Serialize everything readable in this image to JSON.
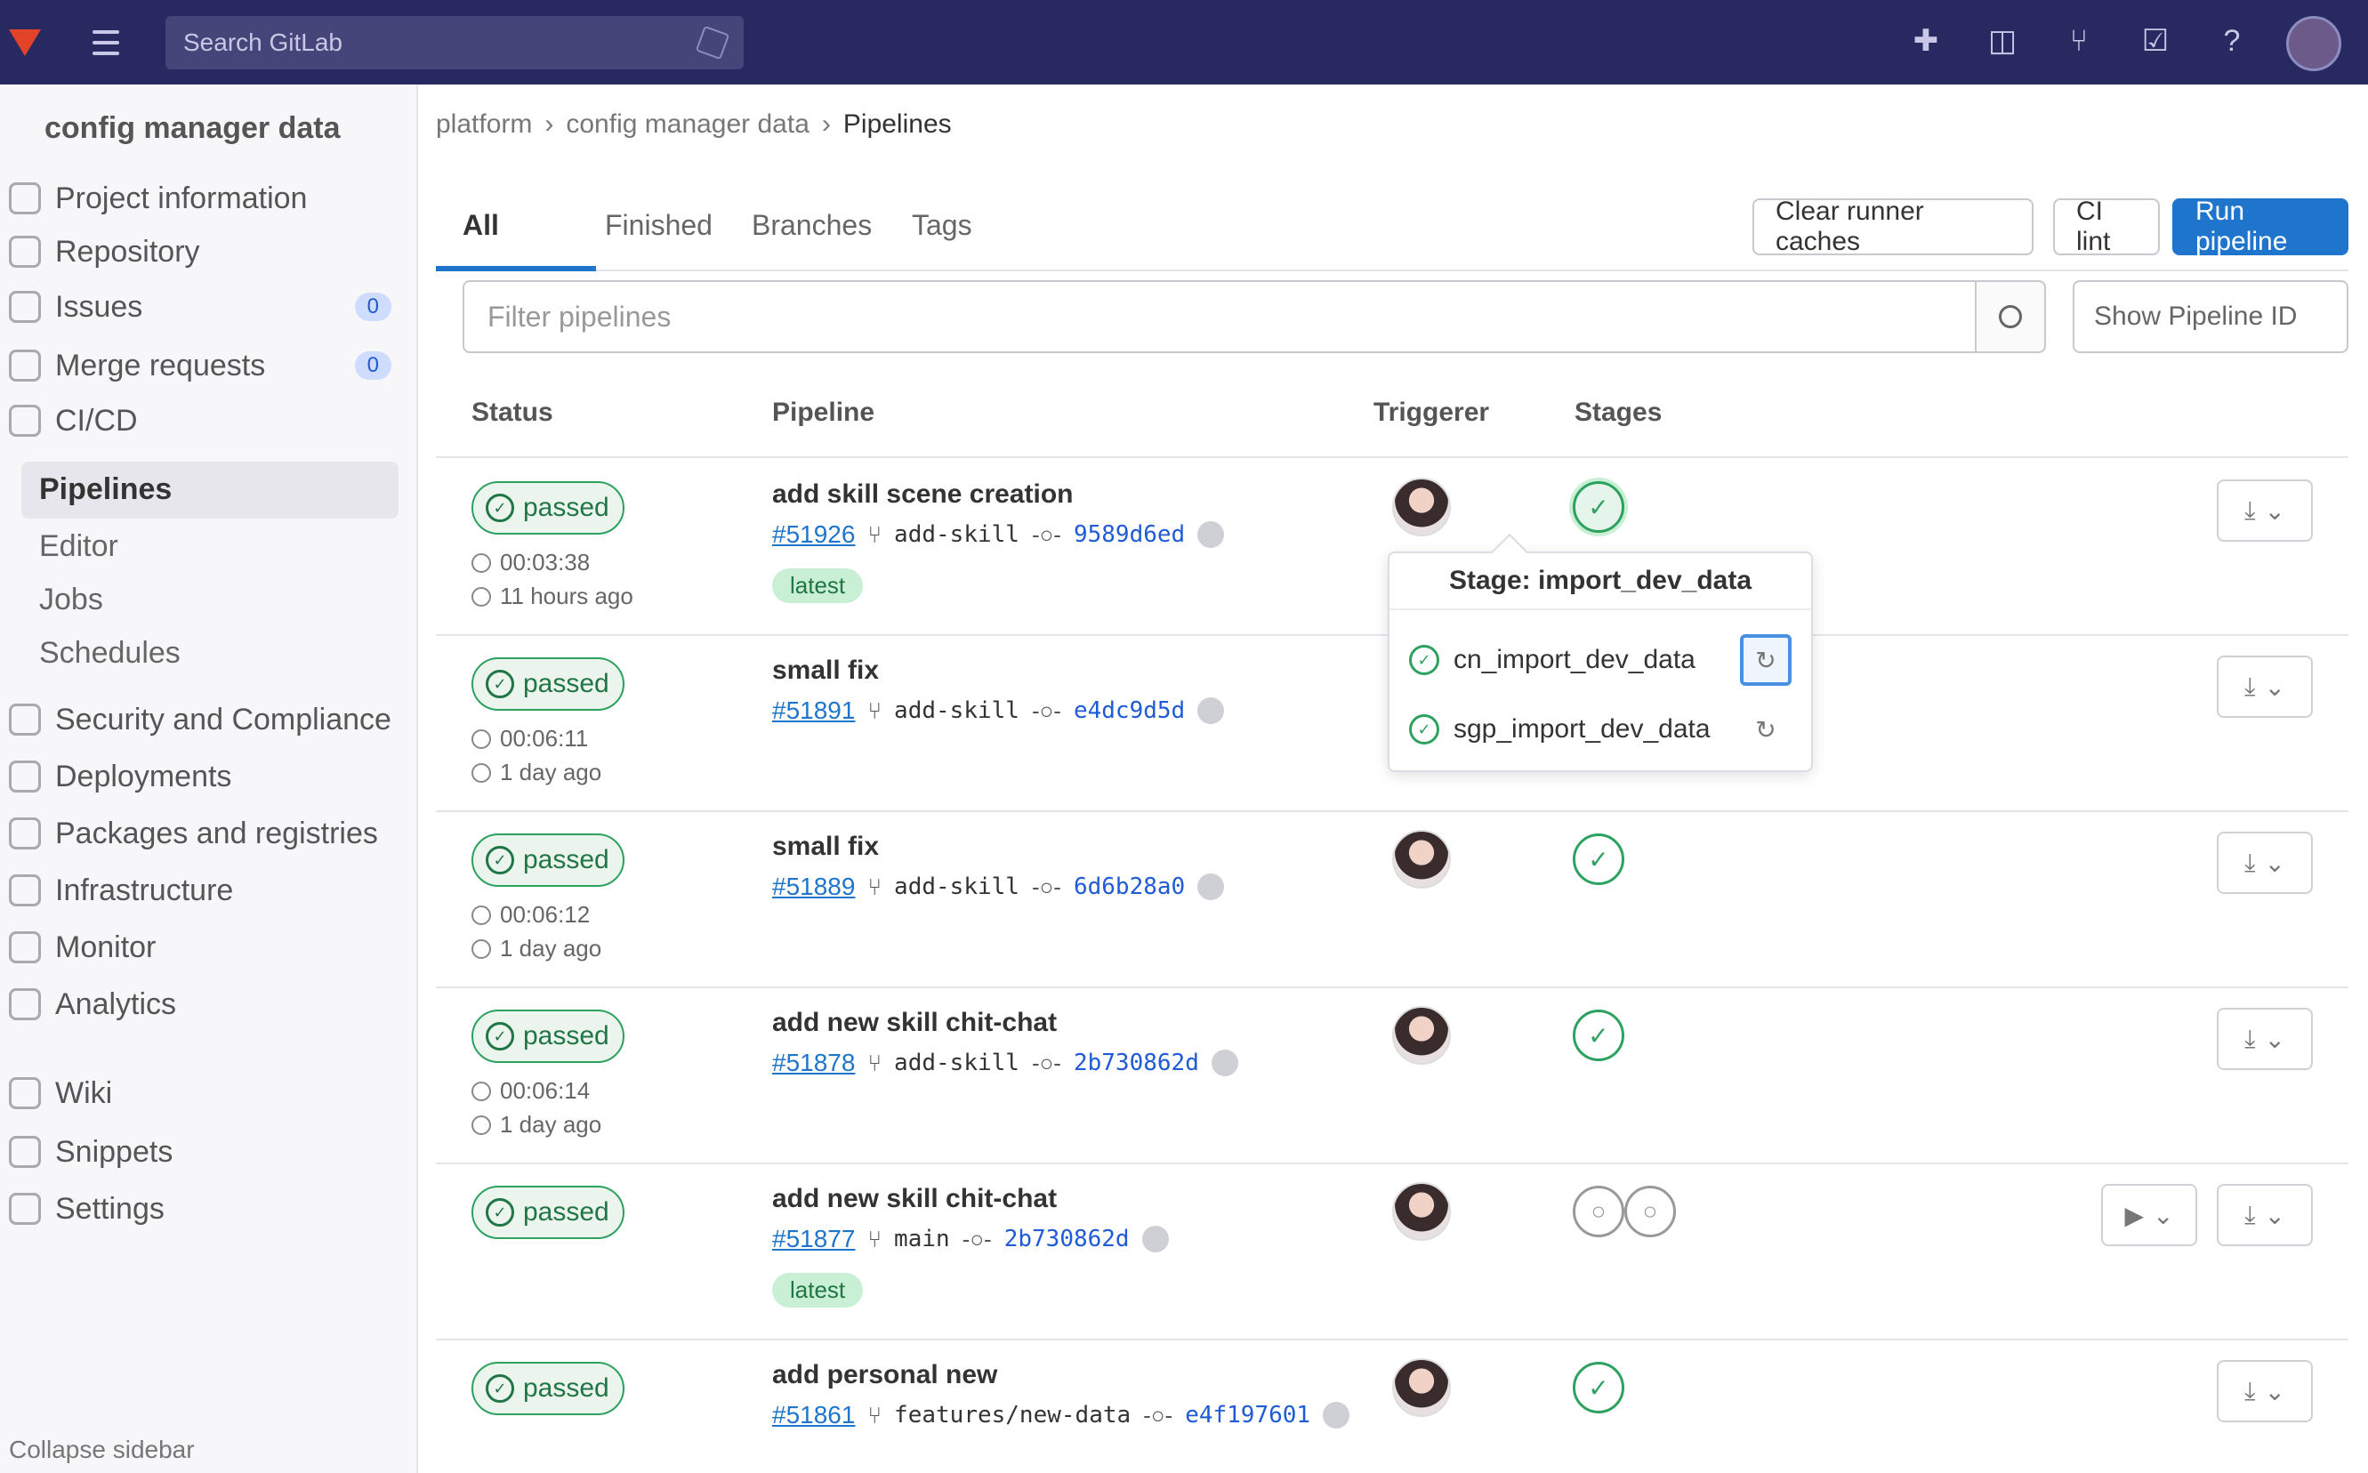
{
  "topbar": {
    "search_placeholder": "Search GitLab",
    "icons": [
      "gitlab-logo-icon",
      "menu-icon",
      "plus-icon",
      "issues-icon",
      "merge-requests-icon",
      "todos-icon",
      "help-icon",
      "user-avatar-icon"
    ]
  },
  "sidebar": {
    "project_name": "config manager data",
    "items": [
      {
        "label": "Project information"
      },
      {
        "label": "Repository"
      },
      {
        "label": "Issues",
        "badge": "0"
      },
      {
        "label": "Merge requests",
        "badge": "0"
      },
      {
        "label": "CI/CD"
      }
    ],
    "cicd_sub": [
      "Pipelines",
      "Editor",
      "Jobs",
      "Schedules"
    ],
    "more_items": [
      "Security and Compliance",
      "Deployments",
      "Packages and registries",
      "Infrastructure",
      "Monitor",
      "Analytics",
      "Wiki",
      "Snippets",
      "Settings"
    ],
    "collapse_label": "Collapse sidebar"
  },
  "breadcrumb": [
    "platform",
    "config manager data",
    "Pipelines"
  ],
  "tabs": {
    "all": "All",
    "all_count": "",
    "finished": "Finished",
    "branches": "Branches",
    "tags": "Tags"
  },
  "buttons": {
    "clear_cache": "Clear runner caches",
    "ci_lint": "CI lint",
    "run_pipeline": "Run pipeline"
  },
  "filter": {
    "placeholder": "Filter pipelines",
    "sort": "Show Pipeline ID"
  },
  "table": {
    "headers": {
      "status": "Status",
      "pipeline": "Pipeline",
      "triggerer": "Triggerer",
      "stages": "Stages"
    },
    "rows": [
      {
        "status": "passed",
        "duration": "00:03:38",
        "ago": "11 hours ago",
        "title": "add skill scene creation",
        "id": "#51926",
        "branch": "add-skill",
        "sha": "9589d6ed",
        "latest": "latest"
      },
      {
        "status": "passed",
        "duration": "00:06:11",
        "ago": "1 day ago",
        "title": "small fix",
        "id": "#51891",
        "branch": "add-skill",
        "sha": "e4dc9d5d",
        "latest": ""
      },
      {
        "status": "passed",
        "duration": "00:06:12",
        "ago": "1 day ago",
        "title": "small fix",
        "id": "#51889",
        "branch": "add-skill",
        "sha": "6d6b28a0",
        "latest": ""
      },
      {
        "status": "passed",
        "duration": "00:06:14",
        "ago": "1 day ago",
        "title": "add new skill chit-chat",
        "id": "#51878",
        "branch": "add-skill",
        "sha": "2b730862d",
        "latest": ""
      },
      {
        "status": "passed",
        "duration": "",
        "ago": "",
        "title": "add new skill chit-chat",
        "id": "#51877",
        "branch": "main",
        "sha": "2b730862d",
        "latest": "latest"
      },
      {
        "status": "passed",
        "duration": "",
        "ago": "",
        "title": "add personal new",
        "id": "#51861",
        "branch": "features/new-data",
        "sha": "e4f197601",
        "latest": ""
      }
    ]
  },
  "popover": {
    "title": "Stage: import_dev_data",
    "jobs": [
      "cn_import_dev_data",
      "sgp_import_dev_data"
    ]
  },
  "colors": {
    "topbar": "#292961",
    "success": "#2da160",
    "link": "#1f75cb"
  }
}
